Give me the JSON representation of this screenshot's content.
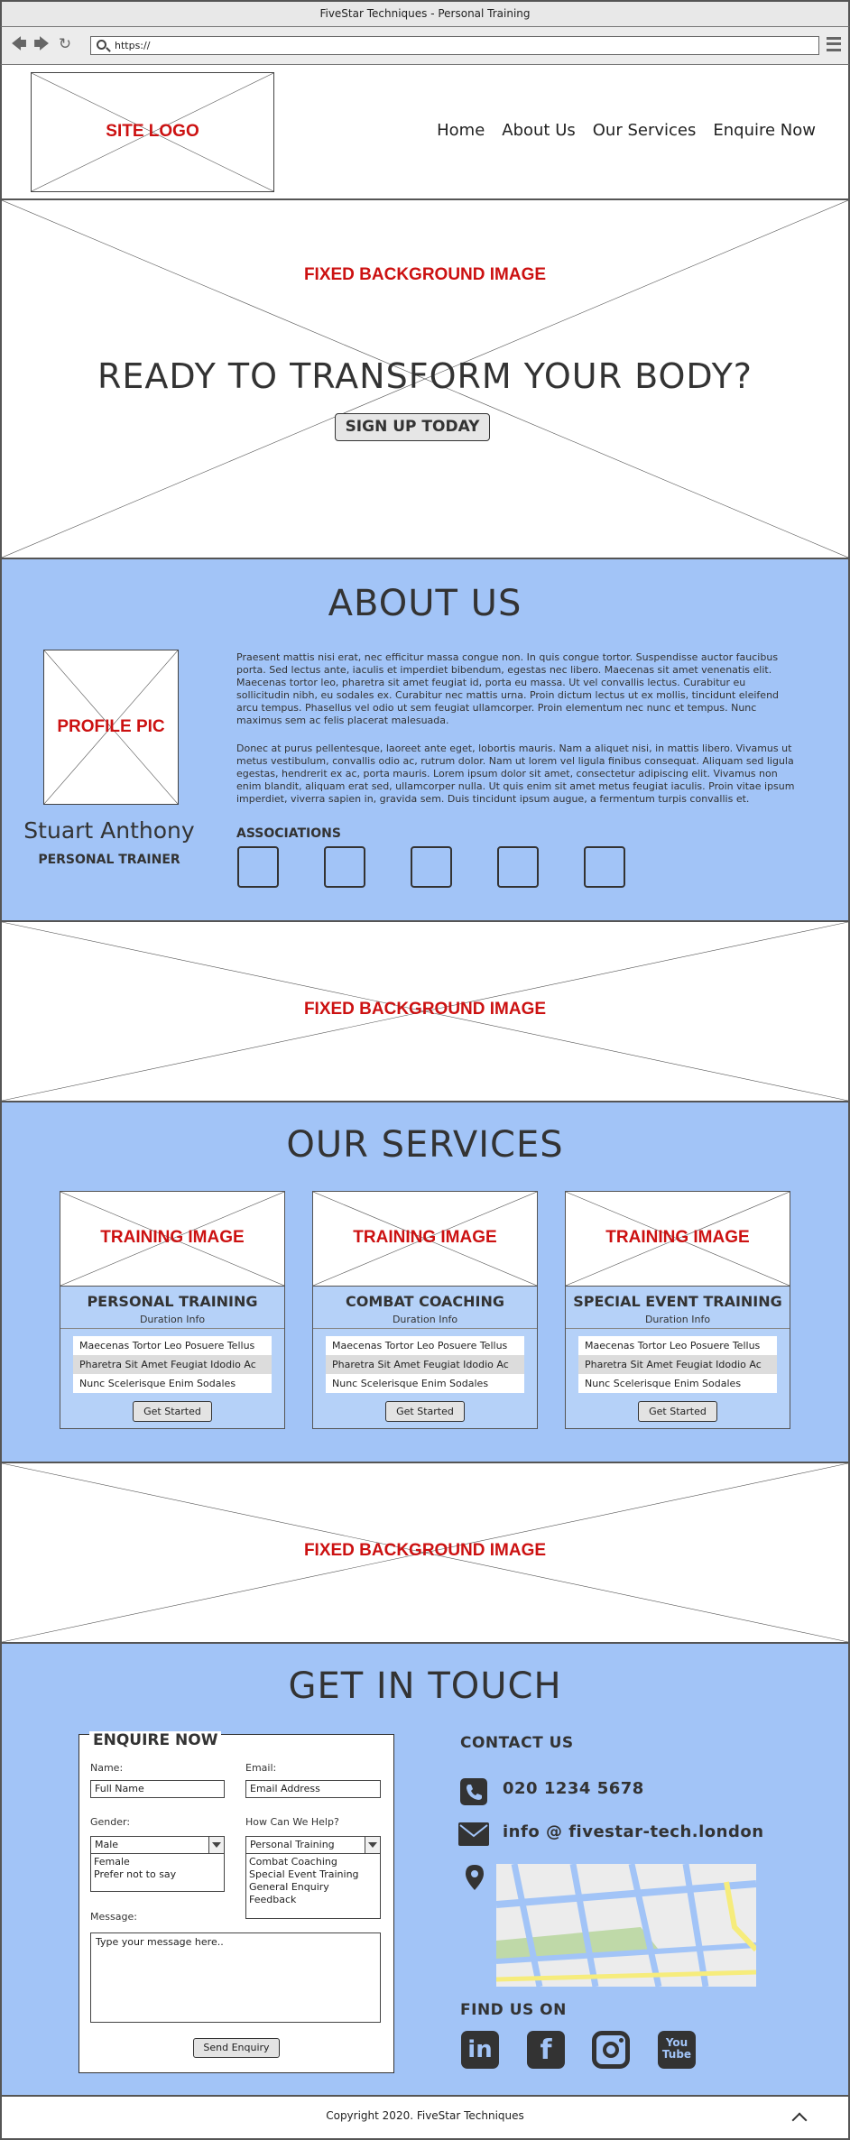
{
  "window": {
    "title": "FiveStar Techniques - Personal Training"
  },
  "browser": {
    "url": "https://"
  },
  "header": {
    "logo_label": "SITE LOGO",
    "nav": [
      "Home",
      "About Us",
      "Our Services",
      "Enquire Now"
    ]
  },
  "hero": {
    "image_label": "FIXED  BACKGROUND IMAGE",
    "heading": "READY TO TRANSFORM YOUR BODY?",
    "cta": "SIGN UP TODAY"
  },
  "about": {
    "title": "ABOUT US",
    "profile_label": "PROFILE PIC",
    "name": "Stuart Anthony",
    "role": "PERSONAL TRAINER",
    "paragraphs": [
      "Praesent mattis nisi erat, nec efficitur massa congue non. In quis congue tortor. Suspendisse auctor faucibus porta. Sed lectus ante, iaculis et imperdiet bibendum, egestas nec libero. Maecenas sit amet venenatis elit. Maecenas tortor leo, pharetra sit amet feugiat id, porta eu massa. Ut vel convallis lectus. Curabitur eu sollicitudin nibh, eu sodales ex. Curabitur nec mattis urna. Proin dictum lectus ut ex mollis, tincidunt eleifend arcu tempus. Phasellus vel odio ut sem feugiat ullamcorper. Proin elementum nec nunc et tempus. Nunc maximus sem ac felis placerat malesuada.",
      "Donec at purus pellentesque, laoreet ante eget, lobortis mauris. Nam a aliquet nisi, in mattis libero. Vivamus ut metus vestibulum, convallis odio ac, rutrum dolor. Nam ut lorem vel ligula finibus consequat. Aliquam sed ligula egestas, hendrerit ex ac, porta mauris. Lorem ipsum dolor sit amet, consectetur adipiscing elit. Vivamus non enim blandit, aliquam erat sed, ullamcorper nulla. Ut quis enim sit amet metus feugiat iaculis. Proin vitae ipsum imperdiet, viverra sapien in, gravida sem. Duis tincidunt ipsum augue, a fermentum turpis convallis et."
    ],
    "associations_title": "ASSOCIATIONS"
  },
  "banner2": {
    "image_label": "FIXED  BACKGROUND IMAGE"
  },
  "services": {
    "title": "OUR SERVICES",
    "image_label": "TRAINING IMAGE",
    "cards": [
      {
        "title": "PERSONAL TRAINING",
        "duration": "Duration Info",
        "items": [
          "Maecenas Tortor Leo Posuere Tellus",
          "Pharetra Sit Amet Feugiat Idodio Ac",
          "Nunc Scelerisque Enim Sodales"
        ],
        "button": "Get Started"
      },
      {
        "title": "COMBAT COACHING",
        "duration": "Duration Info",
        "items": [
          "Maecenas Tortor Leo Posuere Tellus",
          "Pharetra Sit Amet Feugiat Idodio Ac",
          "Nunc Scelerisque Enim Sodales"
        ],
        "button": "Get Started"
      },
      {
        "title": "SPECIAL EVENT TRAINING",
        "duration": "Duration Info",
        "items": [
          "Maecenas Tortor Leo Posuere Tellus",
          "Pharetra Sit Amet Feugiat Idodio Ac",
          "Nunc Scelerisque Enim Sodales"
        ],
        "button": "Get Started"
      }
    ]
  },
  "banner3": {
    "image_label": "FIXED  BACKGROUND IMAGE"
  },
  "contact": {
    "title": "GET IN TOUCH",
    "form": {
      "legend": "ENQUIRE NOW",
      "name_label": "Name:",
      "name_value": "Full Name",
      "email_label": "Email:",
      "email_value": "Email Address",
      "gender_label": "Gender:",
      "gender_value": "Male",
      "gender_options": [
        "Female",
        "Prefer not to say"
      ],
      "help_label": "How Can We Help?",
      "help_value": "Personal Training",
      "help_options": [
        "Combat Coaching",
        "Special Event Training",
        "General Enquiry",
        "Feedback"
      ],
      "message_label": "Message:",
      "message_value": "Type your message here..",
      "submit": "Send Enquiry"
    },
    "contact_title": "CONTACT US",
    "phone": "020 1234 5678",
    "email": "info @ fivestar-tech.london",
    "find_title": "FIND US ON",
    "socials": [
      "linkedin-icon",
      "facebook-icon",
      "instagram-icon",
      "youtube-icon"
    ],
    "youtube_text": [
      "You",
      "Tube"
    ],
    "linkedin_text": "in",
    "facebook_text": "f"
  },
  "footer": {
    "copyright": "Copyright 2020. FiveStar Techniques"
  },
  "colors": {
    "section_blue": "#a2c4f7",
    "placeholder_red": "#cc1111",
    "map_yellow": "#f6ec7c",
    "map_green": "#bfd9a8"
  }
}
